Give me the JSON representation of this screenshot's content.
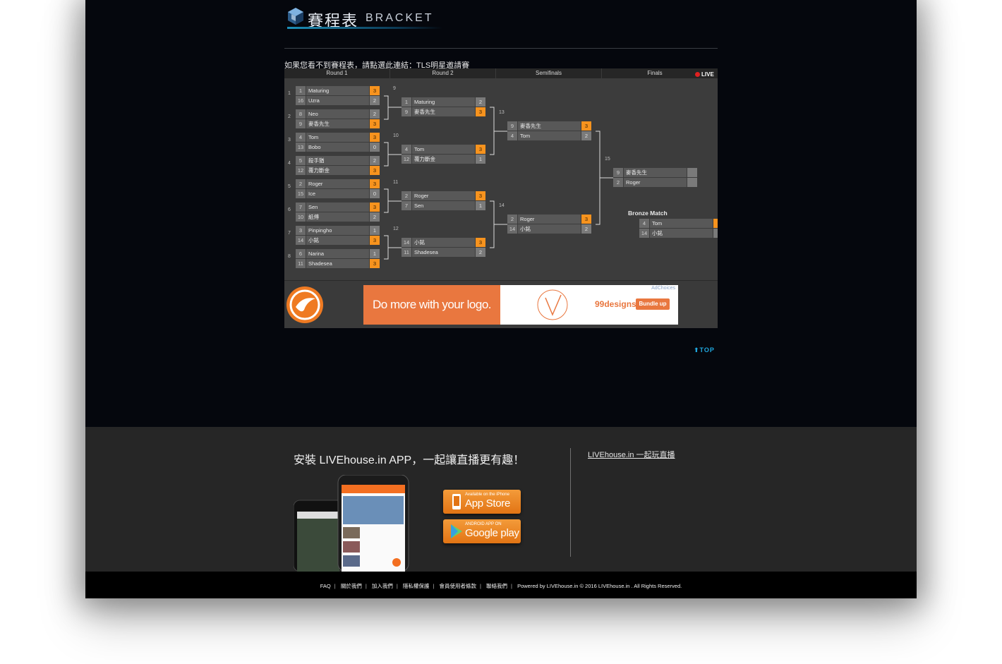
{
  "header": {
    "title_cn": "賽程表",
    "title_en": "BRACKET"
  },
  "notice": {
    "text": "如果您看不到賽程表，請點選此連結：",
    "link": "TLS明星邀請賽"
  },
  "bracket": {
    "rounds": [
      "Round 1",
      "Round 2",
      "Semifinals",
      "Finals"
    ],
    "live": "LIVE",
    "bronze_title": "Bronze Match"
  },
  "ad": {
    "headline": "Do more with your logo.",
    "brand": "99designs",
    "button": "Bundle up",
    "choices": "AdChoices"
  },
  "top_link": "TOP",
  "footer": {
    "app_title": "安裝 LIVEhouse.in APP，一起讓直播更有趣！",
    "link": "LIVEhouse.in 一起玩直播",
    "appstore_small": "Available on the iPhone",
    "appstore_big": "App Store",
    "googleplay_small": "ANDROID APP ON",
    "googleplay_big": "Google play"
  },
  "bottom_links": [
    "FAQ",
    "關於我們",
    "加入我們",
    "隱私權保護",
    "會員使用者條款",
    "聯絡我們"
  ],
  "copyright": "Powered by LIVEhouse.in © 2016 LIVEhouse.in . All Rights Reserved.",
  "colors": {
    "win": "#f7931e",
    "accent": "#20a8e0",
    "bg": "#05070d"
  },
  "matches": [
    {
      "id": "r1m1",
      "label": "1",
      "slots": [
        {
          "seed": "1",
          "name": "Maturing",
          "score": "3",
          "win": true
        },
        {
          "seed": "16",
          "name": "Uzra",
          "score": "2",
          "win": false
        }
      ]
    },
    {
      "id": "r1m2",
      "label": "2",
      "slots": [
        {
          "seed": "8",
          "name": "Neo",
          "score": "2",
          "win": false
        },
        {
          "seed": "9",
          "name": "麥香先生",
          "score": "3",
          "win": true
        }
      ]
    },
    {
      "id": "r1m3",
      "label": "3",
      "slots": [
        {
          "seed": "4",
          "name": "Tom",
          "score": "3",
          "win": true
        },
        {
          "seed": "13",
          "name": "Bobo",
          "score": "0",
          "win": false
        }
      ]
    },
    {
      "id": "r1m4",
      "label": "4",
      "slots": [
        {
          "seed": "5",
          "name": "殺手猶",
          "score": "2",
          "win": false
        },
        {
          "seed": "12",
          "name": "覆力斷金",
          "score": "3",
          "win": true
        }
      ]
    },
    {
      "id": "r1m5",
      "label": "5",
      "slots": [
        {
          "seed": "2",
          "name": "Roger",
          "score": "3",
          "win": true
        },
        {
          "seed": "15",
          "name": "Ice",
          "score": "0",
          "win": false
        }
      ]
    },
    {
      "id": "r1m6",
      "label": "6",
      "slots": [
        {
          "seed": "7",
          "name": "Sen",
          "score": "3",
          "win": true
        },
        {
          "seed": "10",
          "name": "紙傅",
          "score": "2",
          "win": false
        }
      ]
    },
    {
      "id": "r1m7",
      "label": "7",
      "slots": [
        {
          "seed": "3",
          "name": "Pinpingho",
          "score": "1",
          "win": false
        },
        {
          "seed": "14",
          "name": "小銘",
          "score": "3",
          "win": true
        }
      ]
    },
    {
      "id": "r1m8",
      "label": "8",
      "slots": [
        {
          "seed": "6",
          "name": "Narina",
          "score": "1",
          "win": false
        },
        {
          "seed": "11",
          "name": "Shadesea",
          "score": "3",
          "win": true
        }
      ]
    },
    {
      "id": "r2m9",
      "label": "9",
      "slots": [
        {
          "seed": "1",
          "name": "Maturing",
          "score": "2",
          "win": false
        },
        {
          "seed": "9",
          "name": "麥香先生",
          "score": "3",
          "win": true
        }
      ]
    },
    {
      "id": "r2m10",
      "label": "10",
      "slots": [
        {
          "seed": "4",
          "name": "Tom",
          "score": "3",
          "win": true
        },
        {
          "seed": "12",
          "name": "覆力斷金",
          "score": "1",
          "win": false
        }
      ]
    },
    {
      "id": "r2m11",
      "label": "11",
      "slots": [
        {
          "seed": "2",
          "name": "Roger",
          "score": "3",
          "win": true
        },
        {
          "seed": "7",
          "name": "Sen",
          "score": "1",
          "win": false
        }
      ]
    },
    {
      "id": "r2m12",
      "label": "12",
      "slots": [
        {
          "seed": "14",
          "name": "小銘",
          "score": "3",
          "win": true
        },
        {
          "seed": "11",
          "name": "Shadesea",
          "score": "2",
          "win": false
        }
      ]
    },
    {
      "id": "sfm13",
      "label": "13",
      "slots": [
        {
          "seed": "9",
          "name": "麥香先生",
          "score": "3",
          "win": true
        },
        {
          "seed": "4",
          "name": "Tom",
          "score": "2",
          "win": false
        }
      ]
    },
    {
      "id": "sfm14",
      "label": "14",
      "slots": [
        {
          "seed": "2",
          "name": "Roger",
          "score": "3",
          "win": true
        },
        {
          "seed": "14",
          "name": "小銘",
          "score": "2",
          "win": false
        }
      ]
    },
    {
      "id": "fm15",
      "label": "15",
      "slots": [
        {
          "seed": "9",
          "name": "麥香先生",
          "score": "",
          "win": false
        },
        {
          "seed": "2",
          "name": "Roger",
          "score": "",
          "win": false
        }
      ]
    },
    {
      "id": "bronze",
      "label": "",
      "slots": [
        {
          "seed": "4",
          "name": "Tom",
          "score": "",
          "win": true
        },
        {
          "seed": "14",
          "name": "小銘",
          "score": "",
          "win": false
        }
      ]
    }
  ]
}
